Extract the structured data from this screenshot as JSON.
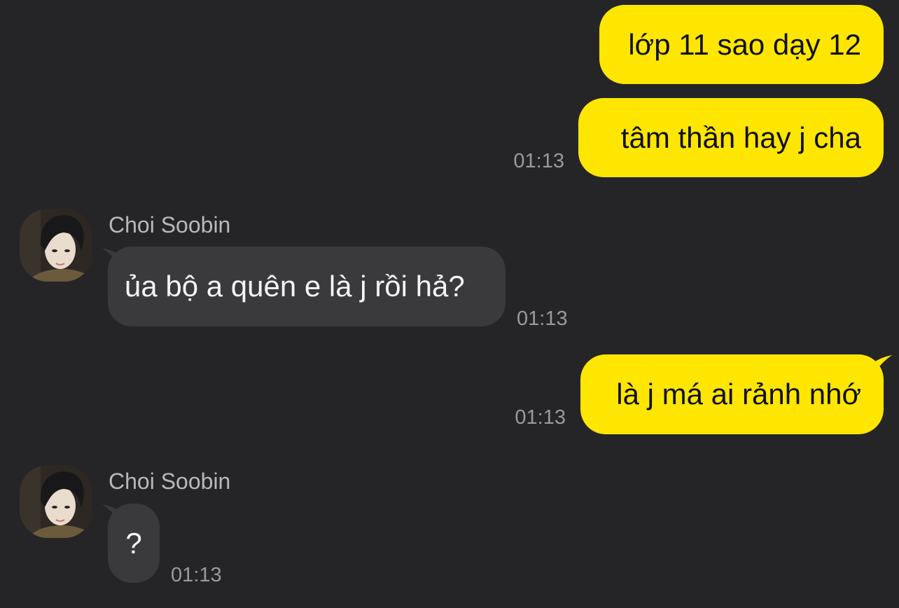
{
  "colors": {
    "background": "#252527",
    "outgoing_bubble": "#FFE600",
    "incoming_bubble": "#3A3A3C",
    "timestamp": "#9A9A9E",
    "sender_name": "#B8B8BC"
  },
  "messages": [
    {
      "direction": "outgoing",
      "text": "lớp 11 sao dạy 12",
      "time": ""
    },
    {
      "direction": "outgoing",
      "text": "tâm thần hay j cha",
      "time": "01:13"
    },
    {
      "direction": "incoming",
      "sender": "Choi Soobin",
      "avatar_icon": "profile-photo-avatar",
      "text": "ủa bộ a quên e là j rồi hả?",
      "time": "01:13"
    },
    {
      "direction": "outgoing",
      "text": "là j má ai rảnh nhớ",
      "time": "01:13"
    },
    {
      "direction": "incoming",
      "sender": "Choi Soobin",
      "avatar_icon": "profile-photo-avatar",
      "text": "?",
      "time": "01:13"
    }
  ]
}
